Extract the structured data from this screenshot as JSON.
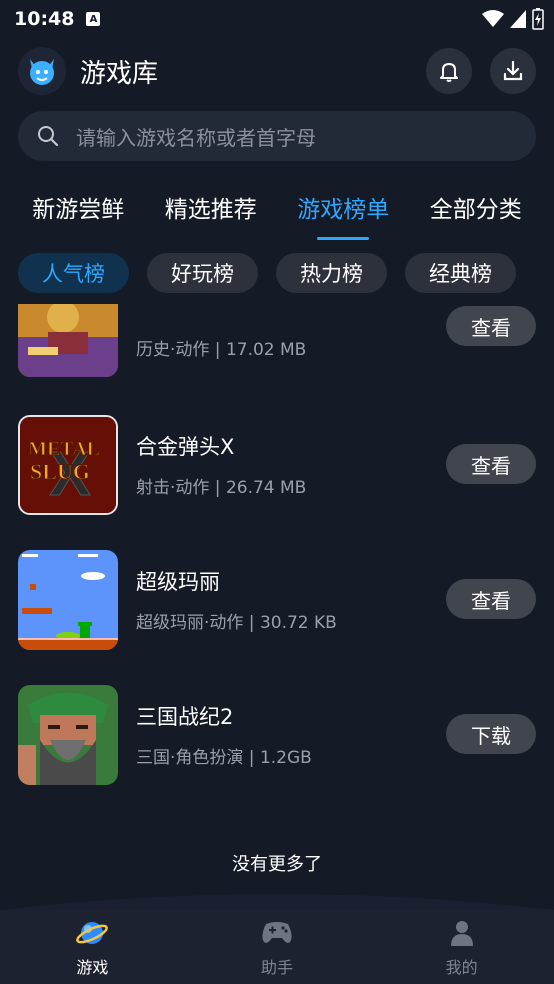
{
  "status_bar": {
    "time": "10:48",
    "notif_badge": "A"
  },
  "header": {
    "title": "游戏库"
  },
  "search": {
    "placeholder": "请输入游戏名称或者首字母"
  },
  "main_tabs": [
    {
      "label": "新游尝鲜",
      "active": false
    },
    {
      "label": "精选推荐",
      "active": false
    },
    {
      "label": "游戏榜单",
      "active": true
    },
    {
      "label": "全部分类",
      "active": false
    }
  ],
  "sub_tabs": [
    {
      "label": "人气榜",
      "active": true
    },
    {
      "label": "好玩榜",
      "active": false
    },
    {
      "label": "热力榜",
      "active": false
    },
    {
      "label": "经典榜",
      "active": false
    }
  ],
  "games": [
    {
      "name": "",
      "meta": "历史·动作 | 17.02 MB",
      "button": "查看"
    },
    {
      "name": "合金弹头X",
      "meta": "射击·动作 | 26.74 MB",
      "button": "查看",
      "thumb_text_1": "METAL",
      "thumb_text_2": "SLUG",
      "thumb_text_3": "X"
    },
    {
      "name": "超级玛丽",
      "meta": "超级玛丽·动作 | 30.72 KB",
      "button": "查看"
    },
    {
      "name": "三国战纪2",
      "meta": "三国·角色扮演 | 1.2GB",
      "button": "下载"
    }
  ],
  "list_footer": "没有更多了",
  "bottom_nav": [
    {
      "label": "游戏",
      "active": true,
      "icon": "planet-icon"
    },
    {
      "label": "助手",
      "active": false,
      "icon": "gamepad-icon"
    },
    {
      "label": "我的",
      "active": false,
      "icon": "user-icon"
    }
  ],
  "colors": {
    "accent": "#2ea7ff",
    "background": "#141a26"
  }
}
